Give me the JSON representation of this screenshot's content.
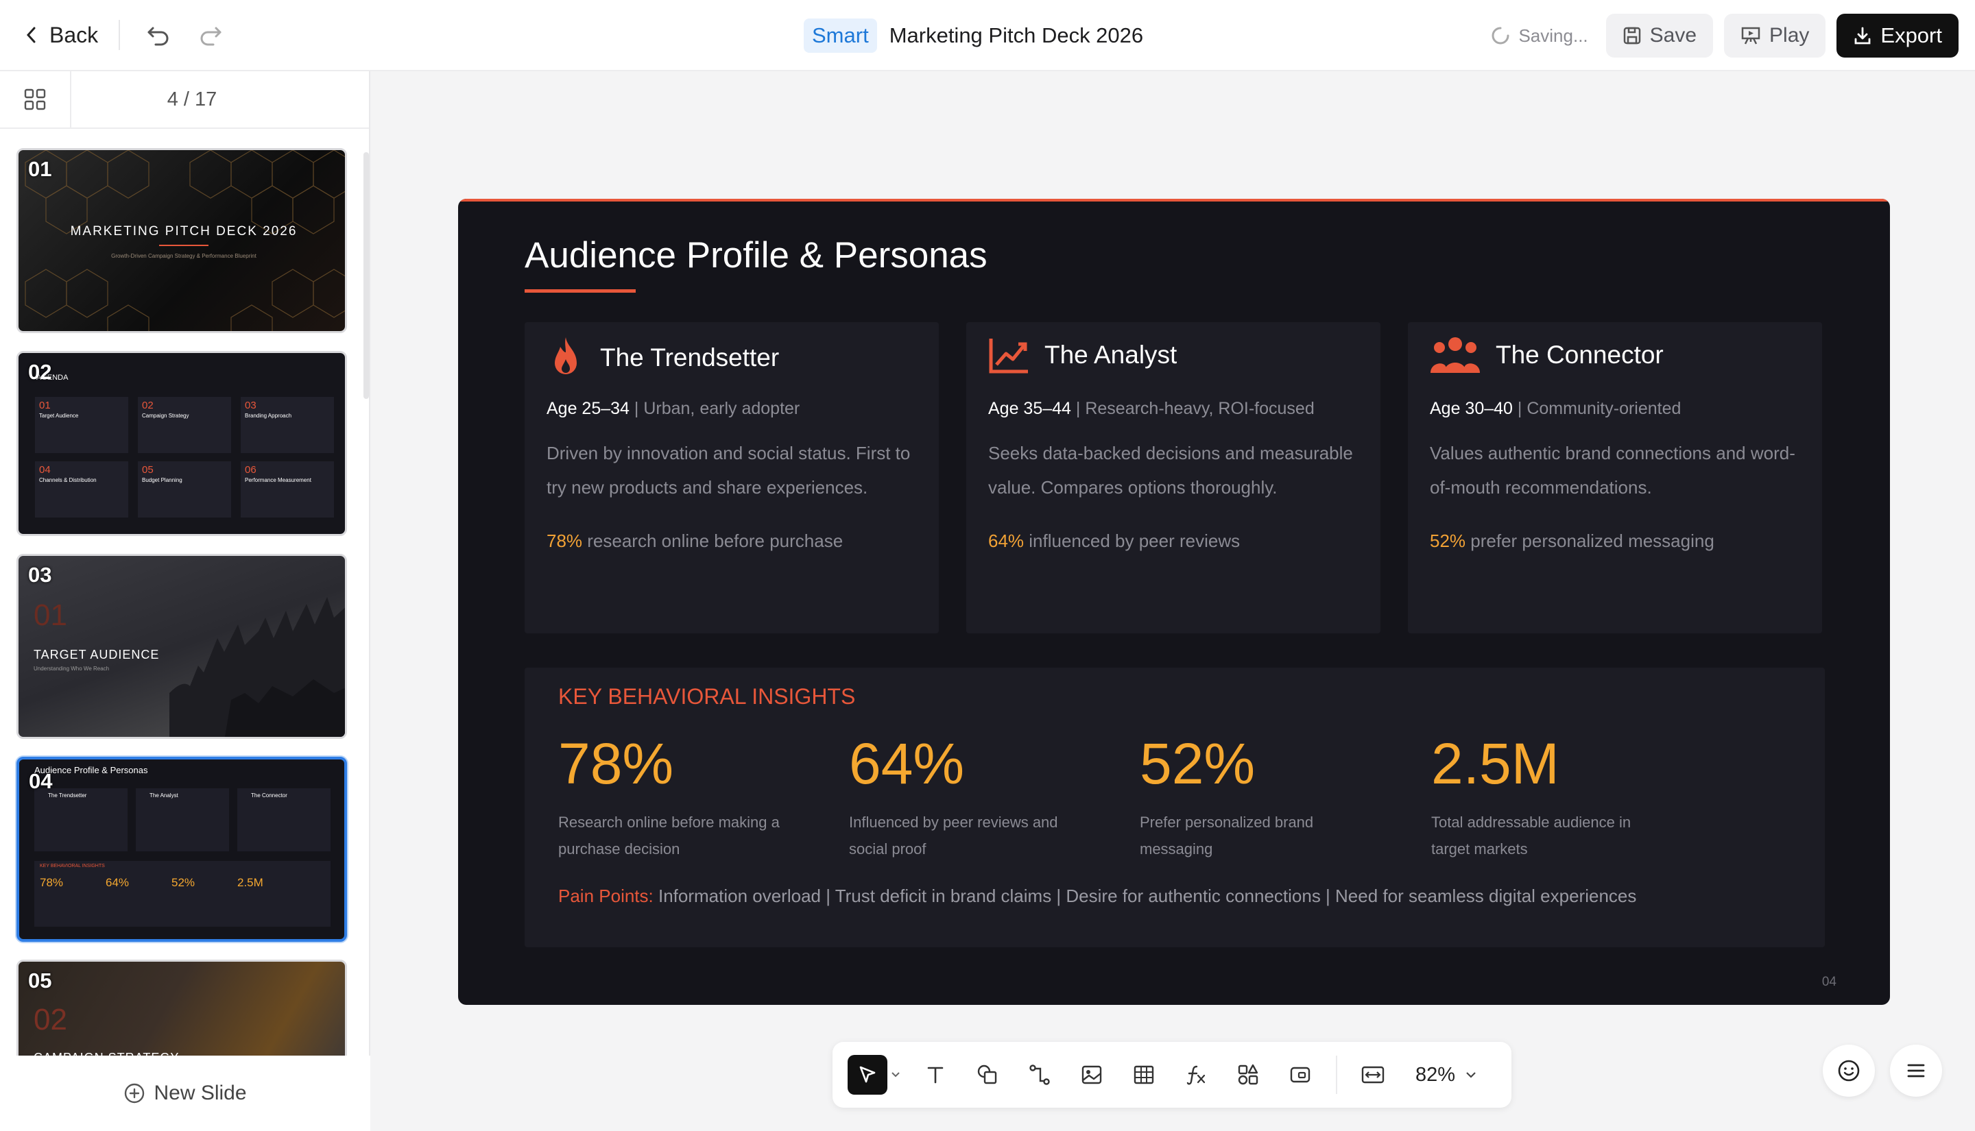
{
  "topbar": {
    "back_label": "Back",
    "badge": "Smart",
    "title": "Marketing Pitch Deck 2026",
    "saving": "Saving...",
    "save": "Save",
    "play": "Play",
    "export": "Export"
  },
  "sidebar": {
    "page_count": "4 / 17",
    "new_slide": "New Slide",
    "thumbs": [
      {
        "num": "01",
        "title": "MARKETING PITCH DECK 2026",
        "subtitle": "Growth-Driven Campaign Strategy & Performance Blueprint"
      },
      {
        "num": "02",
        "heading": "AGENDA",
        "items": [
          {
            "n": "01",
            "t": "Target Audience"
          },
          {
            "n": "02",
            "t": "Campaign Strategy"
          },
          {
            "n": "03",
            "t": "Branding Approach"
          },
          {
            "n": "04",
            "t": "Channels & Distribution"
          },
          {
            "n": "05",
            "t": "Budget Planning"
          },
          {
            "n": "06",
            "t": "Performance Measurement"
          }
        ]
      },
      {
        "num": "03",
        "big": "01",
        "title": "TARGET AUDIENCE",
        "subtitle": "Understanding Who We Reach"
      },
      {
        "num": "04",
        "title": "Audience Profile & Personas",
        "p1": "The Trendsetter",
        "p2": "The Analyst",
        "p3": "The Connector",
        "ins": "KEY BEHAVIORAL INSIGHTS",
        "m1": "78%",
        "m2": "64%",
        "m3": "52%",
        "m4": "2.5M"
      },
      {
        "num": "05",
        "big": "02",
        "title": "CAMPAIGN STRATEGY"
      }
    ]
  },
  "slide": {
    "title": "Audience Profile & Personas",
    "personas": [
      {
        "name": "The Trendsetter",
        "icon": "flame-icon",
        "age": "Age 25–34",
        "demo": " | Urban, early adopter",
        "desc": "Driven by innovation and social status. First to try new products and share experiences.",
        "stat_pct": "78%",
        "stat_text": " research online before purchase"
      },
      {
        "name": "The Analyst",
        "icon": "chart-line-icon",
        "age": "Age 35–44",
        "demo": " | Research-heavy, ROI-focused",
        "desc": "Seeks data-backed decisions and measurable value. Compares options thoroughly.",
        "stat_pct": "64%",
        "stat_text": " influenced by peer reviews"
      },
      {
        "name": "The Connector",
        "icon": "people-icon",
        "age": "Age 30–40",
        "demo": " | Community-oriented",
        "desc": "Values authentic brand connections and word-of-mouth recommendations.",
        "stat_pct": "52%",
        "stat_text": " prefer personalized messaging"
      }
    ],
    "insights": {
      "title": "KEY BEHAVIORAL INSIGHTS",
      "metrics": [
        {
          "value": "78%",
          "desc": "Research online before making a purchase decision"
        },
        {
          "value": "64%",
          "desc": "Influenced by peer reviews and social proof"
        },
        {
          "value": "52%",
          "desc": "Prefer personalized brand messaging"
        },
        {
          "value": "2.5M",
          "desc": "Total addressable audience in target markets"
        }
      ],
      "pain_label": "Pain Points:",
      "pain_text": " Information overload | Trust deficit in brand claims | Desire for authentic connections | Need for seamless digital experiences"
    },
    "page_number": "04"
  },
  "toolbar": {
    "zoom": "82%"
  },
  "colors": {
    "accent": "#e8573a",
    "highlight": "#f5a830",
    "selection": "#2f7ee6",
    "smart_badge": "#1d78d8"
  }
}
